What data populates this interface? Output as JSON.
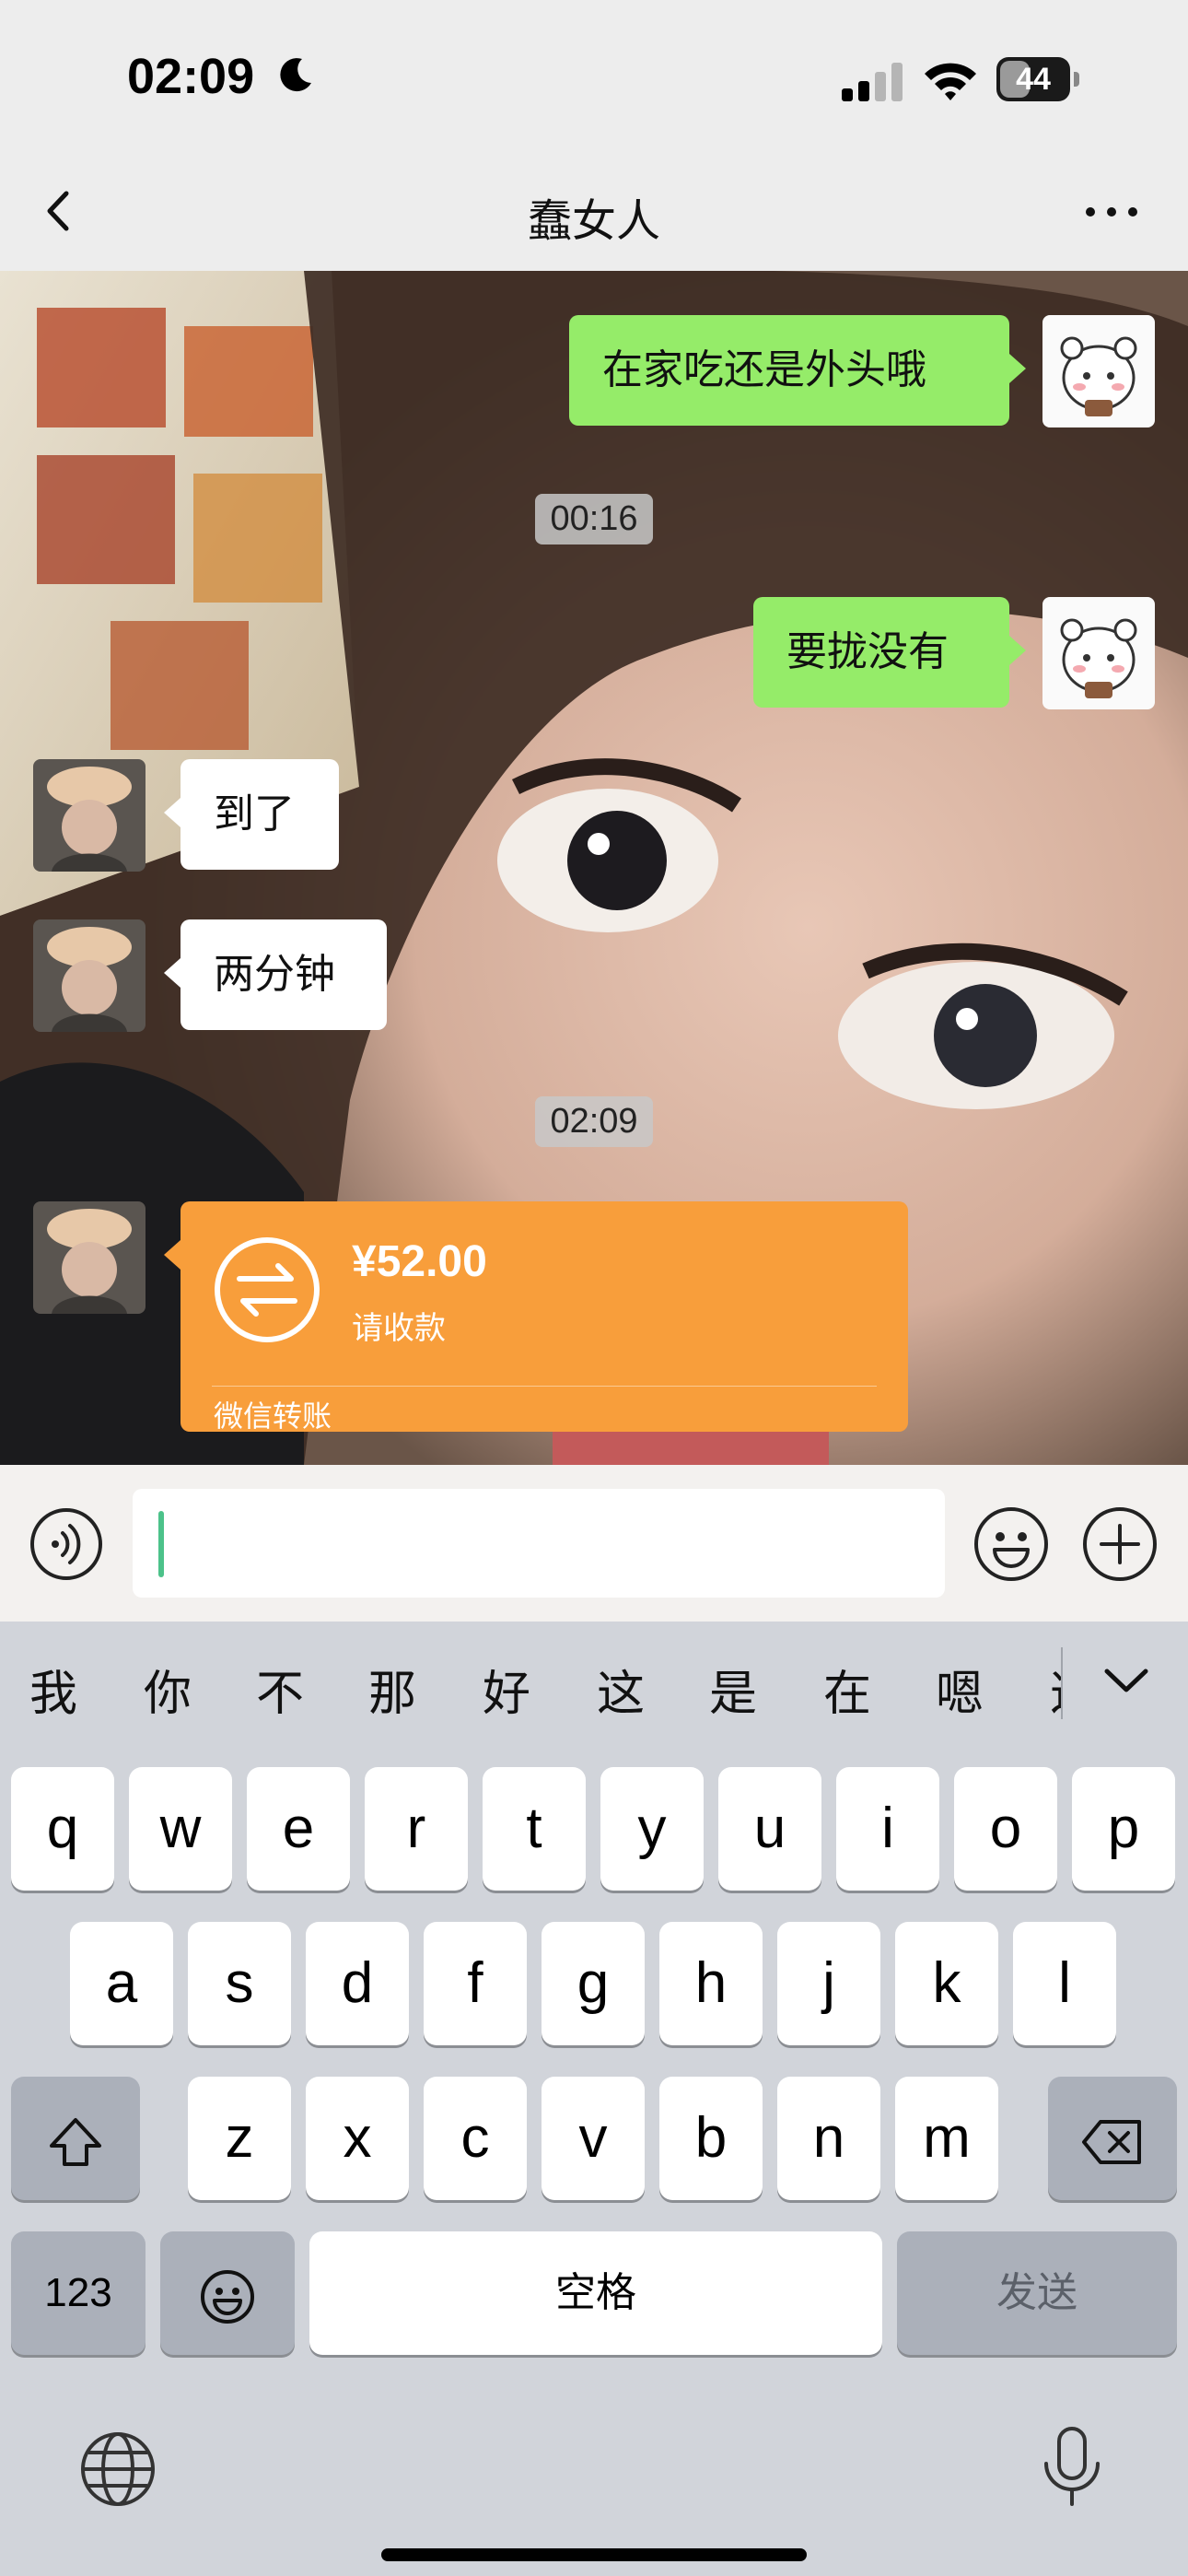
{
  "status_bar": {
    "time": "02:09",
    "battery": "44",
    "battery_level": 0.44
  },
  "nav": {
    "title": "蠢女人"
  },
  "messages": {
    "m1": "在家吃还是外头哦",
    "t1": "00:16",
    "m2": "要拢没有",
    "m3": "到了",
    "m4": "两分钟",
    "t2": "02:09",
    "transfer": {
      "amount": "¥52.00",
      "status": "请收款",
      "label": "微信转账"
    }
  },
  "input": {
    "value": ""
  },
  "keyboard": {
    "candidates": [
      "我",
      "你",
      "不",
      "那",
      "好",
      "这",
      "是",
      "在",
      "嗯",
      "这"
    ],
    "row1": [
      "q",
      "w",
      "e",
      "r",
      "t",
      "y",
      "u",
      "i",
      "o",
      "p"
    ],
    "row2": [
      "a",
      "s",
      "d",
      "f",
      "g",
      "h",
      "j",
      "k",
      "l"
    ],
    "row3": [
      "z",
      "x",
      "c",
      "v",
      "b",
      "n",
      "m"
    ],
    "num_label": "123",
    "space_label": "空格",
    "send_label": "发送"
  },
  "colors": {
    "accent_green": "#95ec69",
    "transfer_orange": "#f89e3b",
    "caret": "#4cc28a"
  }
}
